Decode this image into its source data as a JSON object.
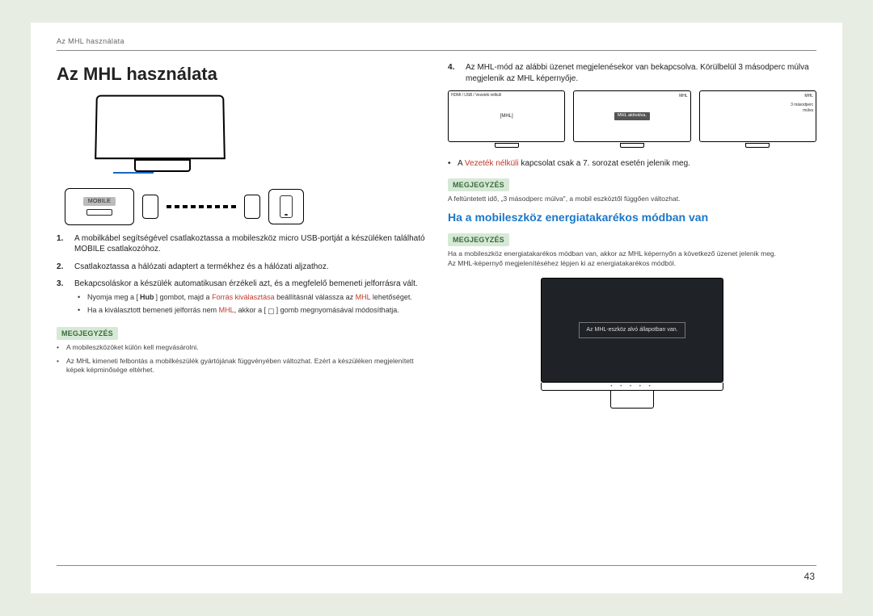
{
  "running_head": "Az MHL használata",
  "title": "Az MHL használata",
  "mobile_port_label": "MOBILE",
  "steps": {
    "s1": "A mobilkábel segítségével csatlakoztassa a mobileszköz micro USB-portját a készüléken található MOBILE csatlakozóhoz.",
    "s2": "Csatlakoztassa a hálózati adaptert a termékhez és a hálózati aljzathoz.",
    "s3": "Bekapcsoláskor a készülék automatikusan érzékeli azt, és a megfelelő bemeneti jelforrásra vált.",
    "s3_sub1_a": "Nyomja meg a [",
    "s3_sub1_hub": "Hub",
    "s3_sub1_b": "] gombot, majd a ",
    "s3_sub1_red": "Forrás kiválasztása",
    "s3_sub1_c": " beállításnál válassza az ",
    "s3_sub1_red2": "MHL",
    "s3_sub1_d": " lehetőséget.",
    "s3_sub2_a": "Ha a kiválasztott bemeneti jelforrás nem ",
    "s3_sub2_red": "MHL",
    "s3_sub2_b": ", akkor a [",
    "s3_sub2_c": "] gomb megnyomásával módosíthatja.",
    "s4": "Az MHL-mód az alábbi üzenet megjelenésekor van bekapcsolva. Körülbelül 3 másodperc múlva megjelenik az MHL képernyője."
  },
  "noteLabel": "MEGJEGYZÉS",
  "note_left_1": "A mobileszközöket külön kell megvásárolni.",
  "note_left_2": "Az MHL kimeneti felbontás a mobilkészülék gyártójának függvényében változhat. Ezért a készüléken megjelenített képek képminősége eltérhet.",
  "right_bullet_a": "A ",
  "right_bullet_red": "Vezeték nélküli",
  "right_bullet_b": " kapcsolat csak a 7. sorozat esetén jelenik meg.",
  "right_note_1": "A feltüntetett idő, „3 másodperc múlva\", a mobil eszköztől függően változhat.",
  "h2": "Ha a mobileszköz energiatakarékos módban van",
  "right_note_2a": "Ha a mobileszköz energiatakarékos módban van, akkor az MHL képernyőn a következő üzenet jelenik meg.",
  "right_note_2b": "Az MHL-képernyő megjelenítéséhez lépjen ki az energiatakarékos módból.",
  "mini_topbar": "HDMI / USB / Vezeték nélküli",
  "mini1_center": "[MHL]",
  "mini2_label": "MHL",
  "mini2_msg": "MHL aktiválva.",
  "mini3_label": "MHL",
  "mini3_badge": "3 másodperc múlva",
  "big_monitor_msg": "Az MHL-eszköz alvó állapotban van.",
  "page_number": "43"
}
